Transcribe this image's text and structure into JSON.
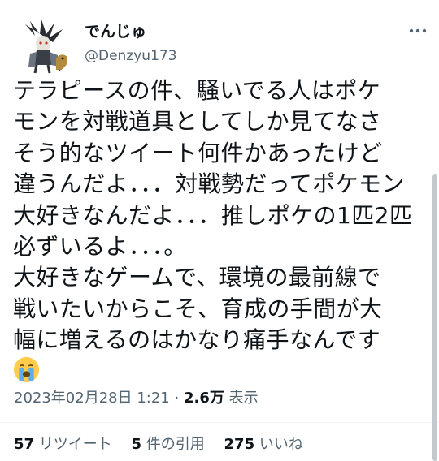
{
  "author": {
    "display_name": "でんじゅ",
    "handle": "@Denzyu173"
  },
  "tweet": {
    "lines": [
      "テラピースの件、騒いでる人はポケ",
      "モンを対戦道具としてしか見てなさ",
      "そう的なツイート何件かあったけど",
      "違うんだよ．．．対戦勢だってポケモン",
      "大好きなんだよ．．．推しポケの1匹2匹",
      "必ずいるよ．．．。",
      "大好きなゲームで、環境の最前線で",
      "戦いたいからこそ、育成の手間が大",
      "幅に増えるのはかなり痛手なんです"
    ],
    "emoji": "loudly-crying-face"
  },
  "meta": {
    "date": "2023年02月28日 1:21",
    "separator": "·",
    "views_count": "2.6万",
    "views_label": "表示"
  },
  "stats": {
    "retweets_count": "57",
    "retweets_label": "リツイート",
    "quotes_count": "5",
    "quotes_label": "件の引用",
    "likes_count": "275",
    "likes_label": "いいね"
  },
  "colors": {
    "text": "#0f1419",
    "secondary": "#536471",
    "divider": "#eff3f4"
  }
}
